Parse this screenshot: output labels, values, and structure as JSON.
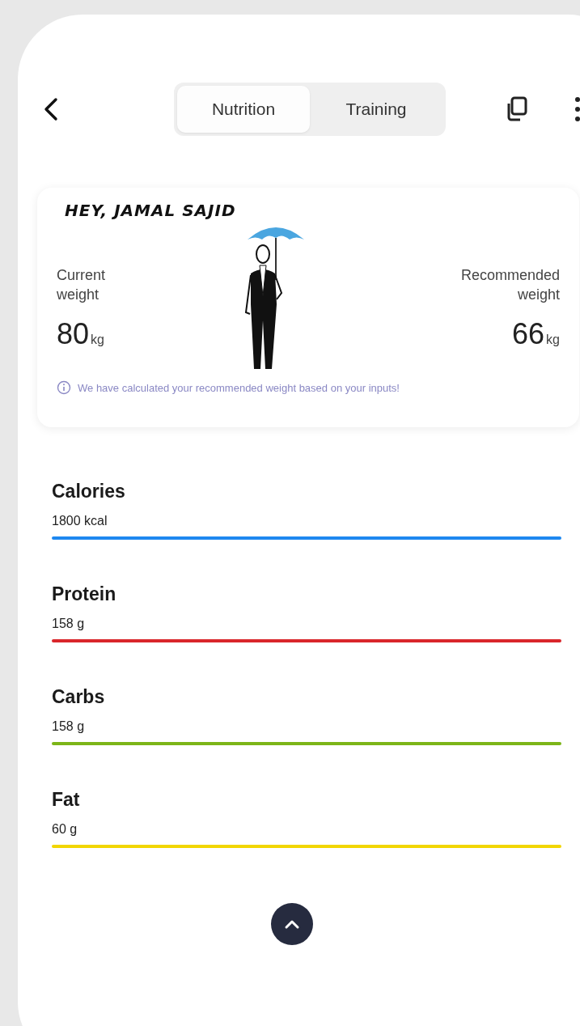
{
  "tabs": [
    {
      "label": "Nutrition",
      "selected": true
    },
    {
      "label": "Training",
      "selected": false
    }
  ],
  "profile_card": {
    "greeting": "HEY, JAMAL SAJID",
    "current_weight": {
      "label": "Current weight",
      "value": "80",
      "unit": "kg"
    },
    "recommended_weight": {
      "label": "Recommended weight",
      "value": "66",
      "unit": "kg"
    },
    "info_note": "We have calculated your recommended weight based on your inputs!"
  },
  "nutrients": [
    {
      "name": "Calories",
      "amount": "1800 kcal",
      "color": "#1e88f0"
    },
    {
      "name": "Protein",
      "amount": "158 g",
      "color": "#d9262b"
    },
    {
      "name": "Carbs",
      "amount": "158 g",
      "color": "#7cb518"
    },
    {
      "name": "Fat",
      "amount": "60 g",
      "color": "#f2d600"
    }
  ]
}
